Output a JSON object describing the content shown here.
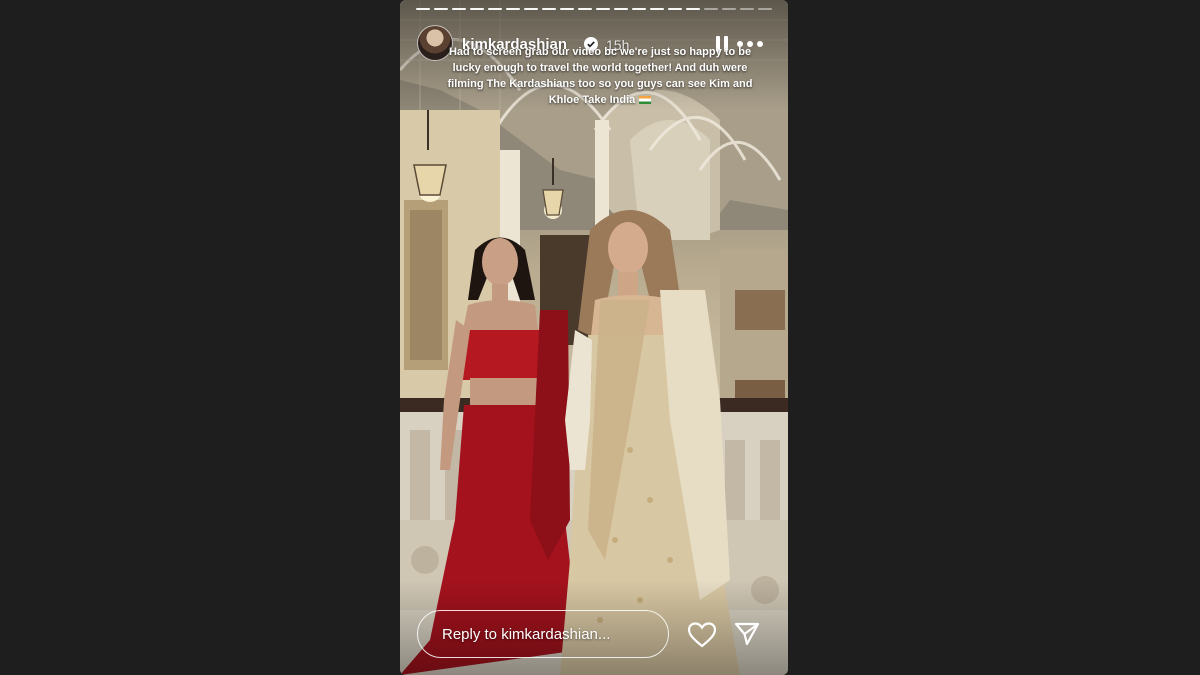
{
  "story": {
    "username": "kimkardashian",
    "time": "15h",
    "caption": "Had to screen grab our video bc we're just so happy to be lucky enough to travel the world together! And duh were filming The Kardashians too so you guys can see Kim and Khloe Take India",
    "caption_flag": "india-flag",
    "progress_segments_done": 16,
    "progress_segments_total": 20
  },
  "reply": {
    "placeholder": "Reply to kimkardashian..."
  },
  "icons": {
    "verified": "verified-badge-icon",
    "pause": "pause-icon",
    "more": "more-options-icon",
    "like": "heart-icon",
    "share": "send-icon"
  },
  "colors": {
    "page_background": "#1e1e1e",
    "saree_red": "#a3121d",
    "lehenga_gold": "#d8c7a3"
  }
}
